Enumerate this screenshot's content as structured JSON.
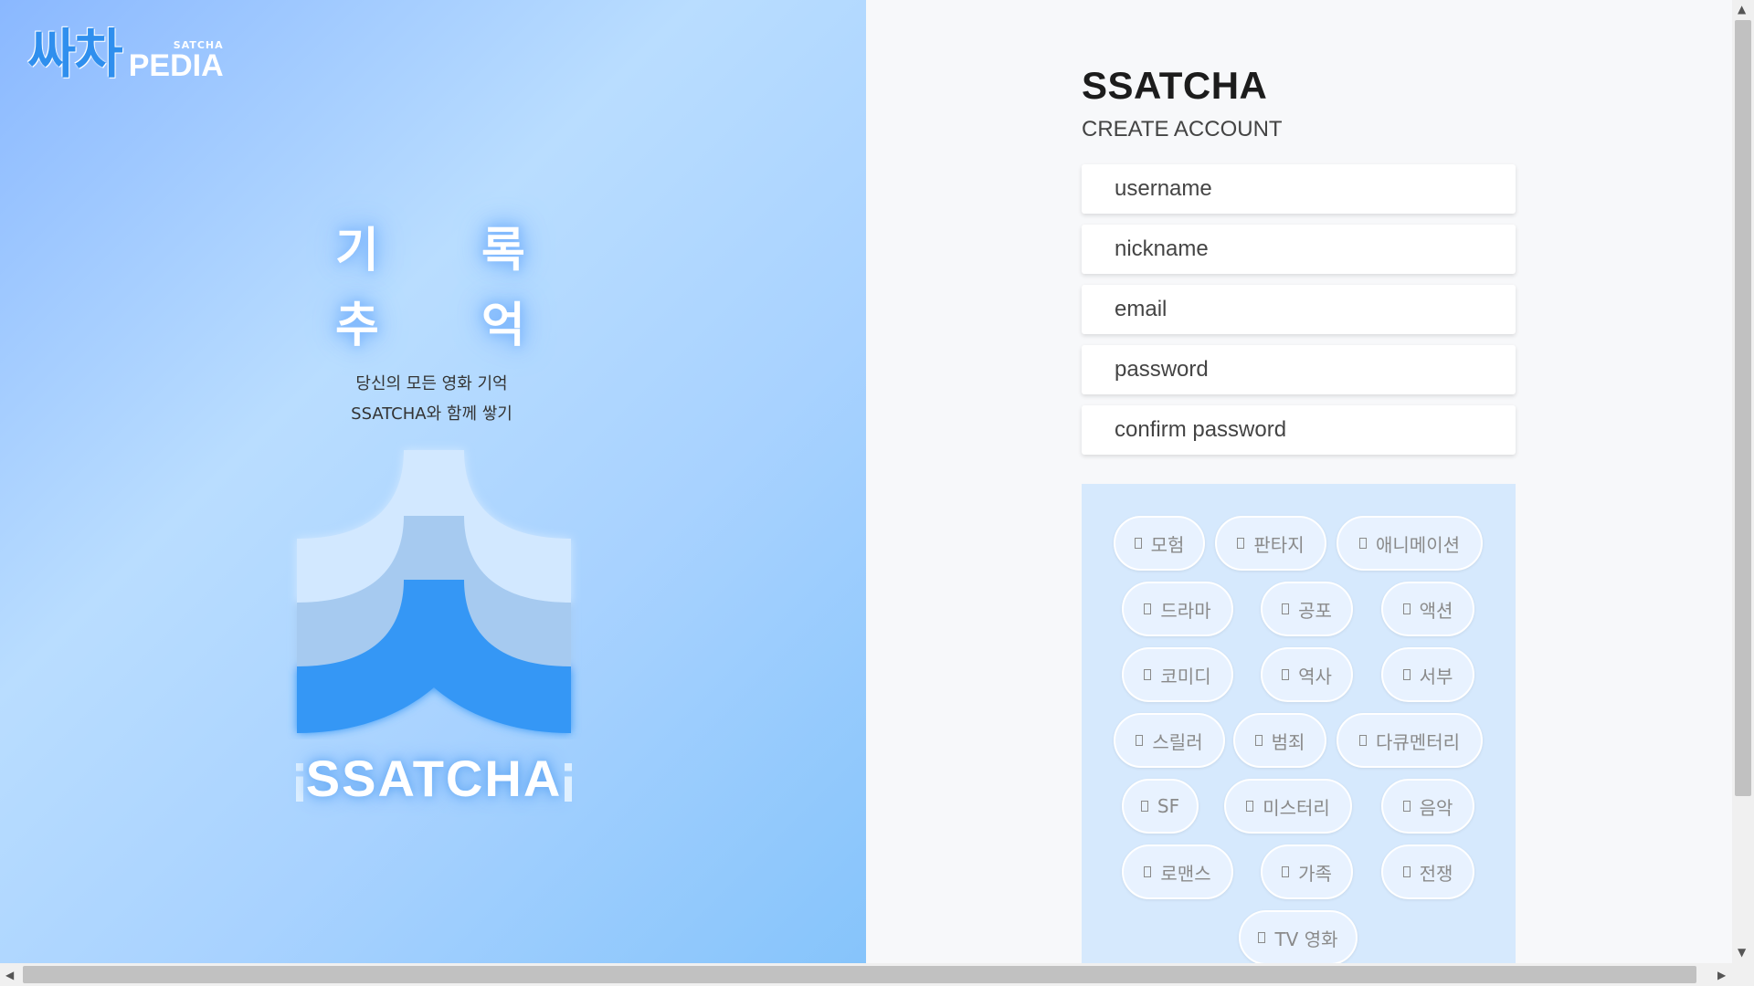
{
  "brand": {
    "korean": "싸차",
    "small": "SATCHA",
    "pedia": "PEDIA"
  },
  "hero": {
    "chars": [
      "기",
      "록",
      "추",
      "억"
    ],
    "tagline_1": "당신의 모든 영화 기억",
    "tagline_2": "SSATCHA와 함께 쌓기",
    "logo_text": "SSATCHA"
  },
  "form": {
    "title": "SSATCHA",
    "subtitle": "CREATE ACCOUNT",
    "fields": {
      "username": "username",
      "nickname": "nickname",
      "email": "email",
      "password": "password",
      "confirm_password": "confirm password"
    }
  },
  "genres": [
    "모험",
    "판타지",
    "애니메이션",
    "드라마",
    "공포",
    "액션",
    "코미디",
    "역사",
    "서부",
    "스릴러",
    "범죄",
    "다큐멘터리",
    "SF",
    "미스터리",
    "음악",
    "로맨스",
    "가족",
    "전쟁",
    "TV 영화"
  ],
  "colors": {
    "accent": "#2f8fee",
    "genre_bg": "#d6e9fd",
    "panel_bg": "#f7f8fa"
  }
}
